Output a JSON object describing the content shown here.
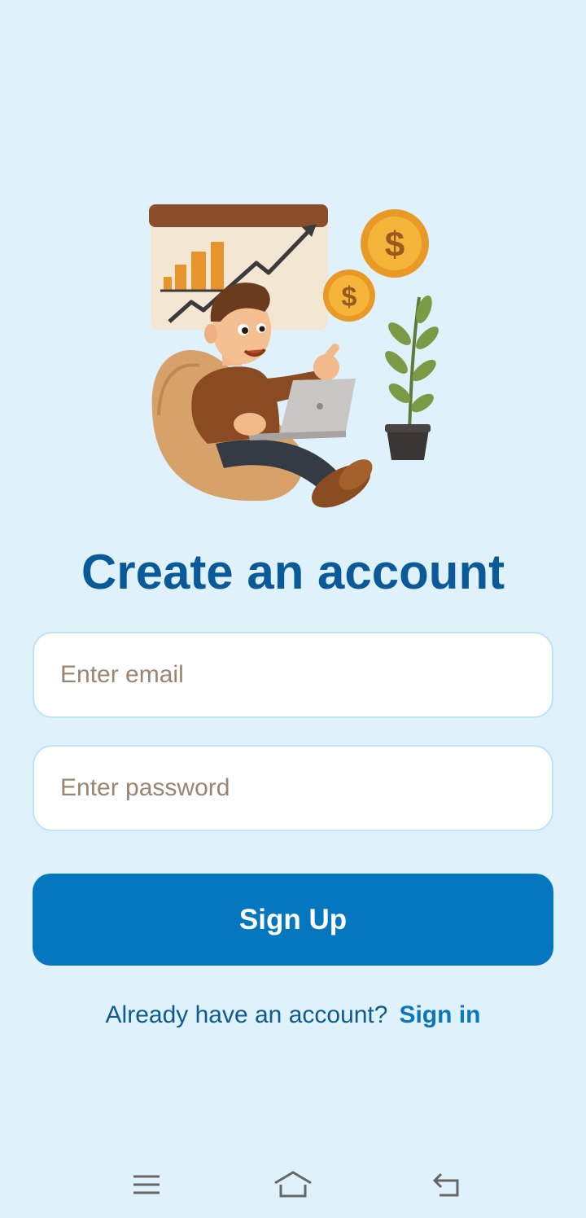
{
  "illustration": {
    "description_icon": "person-with-laptop-growth-chart-illustration",
    "coin_symbol": "$"
  },
  "title": "Create an account",
  "form": {
    "email_placeholder": "Enter email",
    "password_placeholder": "Enter password",
    "submit_label": "Sign Up"
  },
  "signin": {
    "prompt": "Already have an account?",
    "link_label": "Sign in"
  },
  "navbar": {
    "items": [
      "menu-icon",
      "home-icon",
      "back-icon"
    ]
  },
  "colors": {
    "background": "#dff2fc",
    "title": "#0a5a9a",
    "button": "#0477be",
    "link": "#0a78b8",
    "placeholder": "#9b8470"
  }
}
